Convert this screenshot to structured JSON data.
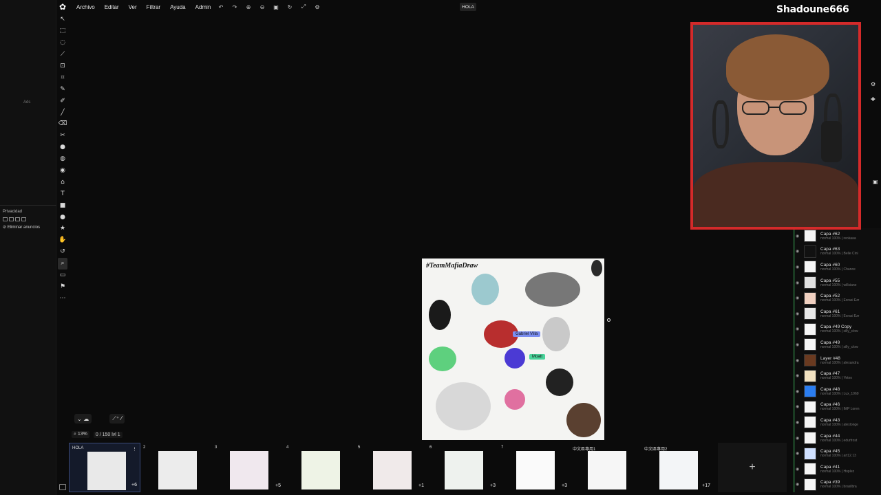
{
  "menu": {
    "logo": "✿",
    "items": [
      "Archivo",
      "Editar",
      "Ver",
      "Filtrar",
      "Ayuda",
      "Admin"
    ],
    "icons": [
      "undo-icon",
      "redo-icon",
      "zoom-in-icon",
      "zoom-out-icon",
      "fit-icon",
      "rotate-icon",
      "fullscreen-icon",
      "settings-icon"
    ],
    "icon_glyphs": [
      "↶",
      "↷",
      "⊕",
      "⊖",
      "▣",
      "↻",
      "⤢",
      "⚙"
    ],
    "document_title": "HOLA"
  },
  "ads": {
    "label": "Ads",
    "privacy": "Privacidad",
    "remove_ads": "⊘ Eliminar anuncios"
  },
  "toolbar": {
    "glyphs": [
      "↖",
      "⬚",
      "◌",
      "⟋",
      "⊡",
      "⌗",
      "✎",
      "✐",
      "╱",
      "⌫",
      "✂",
      "●",
      "◍",
      "◉",
      "⌂",
      "T",
      "■",
      "●",
      "★",
      "✋",
      "↺",
      "⌕",
      "▭",
      "⚑",
      "⋯"
    ],
    "names": [
      "move-icon",
      "select-rect-icon",
      "select-ellipse-icon",
      "lasso-icon",
      "transform-icon",
      "crop-icon",
      "pencil-icon",
      "pen-icon",
      "brush-icon",
      "eraser-icon",
      "smudge-icon",
      "blur-icon",
      "fill-icon",
      "gradient-icon",
      "stamp-icon",
      "text-icon",
      "rect-shape-icon",
      "ellipse-shape-icon",
      "star-shape-icon",
      "hand-icon",
      "rotate-view-icon",
      "zoom-icon",
      "comment-icon",
      "flag-icon",
      "more-icon"
    ]
  },
  "canvas": {
    "title": "#TeamMafiaDraw",
    "tag1": "Gabriel Villa",
    "tag2": "Moatt"
  },
  "bottom": {
    "zoom": "⌕ 13%",
    "status": "0 / 150  lvl 1",
    "chat_glyph": "⌄ ☁",
    "brush_glyph": "⟋⁺ ⁄"
  },
  "pages": [
    {
      "label": "HOLA",
      "badge": "+6"
    },
    {
      "label": "2",
      "badge": ""
    },
    {
      "label": "3",
      "badge": "+5"
    },
    {
      "label": "4",
      "badge": ""
    },
    {
      "label": "5",
      "badge": "+1"
    },
    {
      "label": "6",
      "badge": "+3"
    },
    {
      "label": "7",
      "badge": "+3"
    },
    {
      "label": "中文區專用1",
      "badge": ""
    },
    {
      "label": "中文區專用2",
      "badge": "+17"
    }
  ],
  "add_page": "+",
  "streamer_name": "Shadoune666",
  "layers": [
    {
      "name": "Capa #62",
      "meta": "normal 100% | reokaaa"
    },
    {
      "name": "Capa #63",
      "meta": "normal 100% | Belle Cini"
    },
    {
      "name": "Capa #60",
      "meta": "normal 100% | Chance"
    },
    {
      "name": "Capa #55",
      "meta": "normal 100% | willsiano"
    },
    {
      "name": "Capa #52",
      "meta": "normal 100% | Exrasi Ezr"
    },
    {
      "name": "Capa #61",
      "meta": "normal 100% | Exrasi Ezr"
    },
    {
      "name": "Capa #49 Copy",
      "meta": "normal 100% | silly_clow"
    },
    {
      "name": "Capa #49",
      "meta": "normal 100% | silly_clow"
    },
    {
      "name": "Layer #48",
      "meta": "normal 100% | alexandra"
    },
    {
      "name": "Capa #47",
      "meta": "normal 100% | Yetno"
    },
    {
      "name": "Capa #48",
      "meta": "normal 100% | Lux_1069"
    },
    {
      "name": "Capa #46",
      "meta": "normal 100% | IMP Loren"
    },
    {
      "name": "Capa #43",
      "meta": "normal 100% | alexlonge"
    },
    {
      "name": "Capa #44",
      "meta": "normal 100% | edurfrost"
    },
    {
      "name": "Capa #45",
      "meta": "normal 100% | art12.13"
    },
    {
      "name": "Capa #41",
      "meta": "normal 100% | Hoplez"
    },
    {
      "name": "Capa #39",
      "meta": "normal 100% | brasilbra"
    }
  ],
  "colors": {
    "accent": "#3a4a7a",
    "webcam_border": "#d42a2a",
    "tag1_bg": "#7b8ef0",
    "tag2_bg": "#49d39a"
  }
}
